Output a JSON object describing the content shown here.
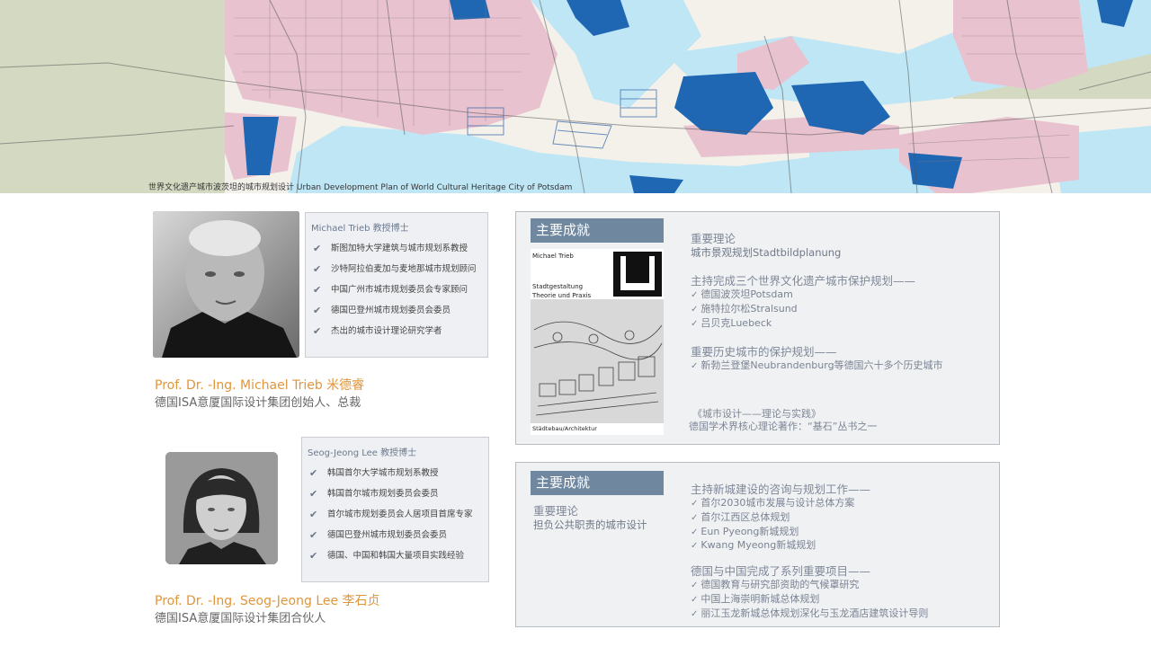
{
  "banner": {
    "caption": "世界文化遗产城市波茨坦的城市规划设计 Urban Development Plan of World Cultural Heritage City of Potsdam",
    "image_icon": "city-map-image"
  },
  "colors": {
    "accent_orange": "#e0953a",
    "tag_blue": "#6f88a0",
    "panel_bg": "#f0f1f3",
    "map_water": "#bfe6f5",
    "map_blue": "#1f66b3",
    "map_pink": "#e8c2cf"
  },
  "profiles": [
    {
      "card_title": "Michael Trieb 教授博士",
      "items": [
        "斯图加特大学建筑与城市规划系教授",
        "沙特阿拉伯麦加与麦地那城市规划顾问",
        "中国广州市城市规划委员会专家顾问",
        "德国巴登州城市规划委员会委员",
        "杰出的城市设计理论研究学者"
      ],
      "name": "Prof. Dr. -Ing. Michael Trieb 米德睿",
      "role": "德国ISA意厦国际设计集团创始人、总裁",
      "photo_icon": "portrait-photo"
    },
    {
      "card_title": "Seog-Jeong Lee 教授博士",
      "items": [
        "韩国首尔大学城市规划系教授",
        "韩国首尔城市规划委员会委员",
        "首尔城市规划委员会人居项目首席专家",
        "德国巴登州城市规划委员会委员",
        "德国、中国和韩国大量项目实践经验"
      ],
      "name": "Prof. Dr. -Ing. Seog-Jeong Lee  李石贞",
      "role": "德国ISA意厦国际设计集团合伙人",
      "photo_icon": "portrait-photo"
    }
  ],
  "panel1": {
    "tag": "主要成就",
    "book": {
      "author": "Michael Trieb",
      "title_line1": "Stadtgestaltung",
      "title_line2": "Theorie und Praxis",
      "footer": "Städtebau/Architektur"
    },
    "blocks": [
      {
        "head": "重要理论",
        "lines": [
          "城市景观规划Stadtbildplanung"
        ],
        "checks": []
      },
      {
        "head": "主持完成三个世界文化遗产城市保护规划——",
        "lines": [],
        "checks": [
          "德国波茨坦Potsdam",
          "施特拉尔松Stralsund",
          "吕贝克Luebeck"
        ]
      },
      {
        "head": "重要历史城市的保护规划——",
        "lines": [],
        "checks": [
          "新勃兰登堡Neubrandenburg等德国六十多个历史城市"
        ]
      }
    ],
    "quote_line1": "《城市设计——理论与实践》",
    "quote_line2": "德国学术界核心理论著作：“基石”丛书之一"
  },
  "panel2": {
    "tag": "主要成就",
    "left_head": "重要理论",
    "left_sub": "担负公共职责的城市设计",
    "blocks": [
      {
        "head": "主持新城建设的咨询与规划工作——",
        "checks": [
          "首尔2030城市发展与设计总体方案",
          "首尔江西区总体规划",
          "Eun Pyeong新城规划",
          "Kwang Myeong新城规划"
        ]
      },
      {
        "head": "德国与中国完成了系列重要项目——",
        "checks": [
          "德国教育与研究部资助的气候罩研究",
          "中国上海崇明新城总体规划",
          "丽江玉龙新城总体规划深化与玉龙酒店建筑设计导则"
        ]
      }
    ]
  }
}
